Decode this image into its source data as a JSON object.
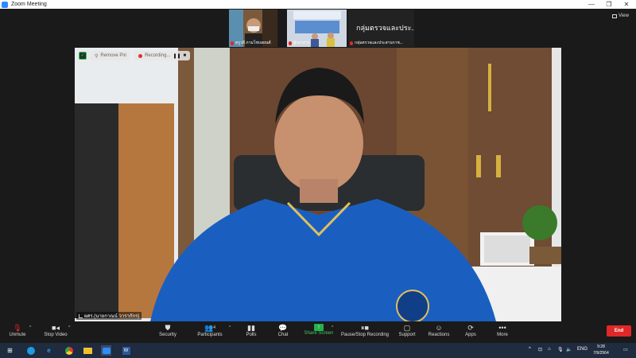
{
  "window": {
    "title": "Zoom Meeting",
    "minimize": "—",
    "maximize": "❐",
    "close": "✕"
  },
  "view_button": "View",
  "thumbnails": [
    {
      "name": "ครูวลี ภามโชบลยนต์"
    },
    {
      "name": "ผู้กสาภาร"
    },
    {
      "name": "กลุ่มตรวจและประสานราช...",
      "big_name": "กลุ่มตรวจและประ..."
    }
  ],
  "main_video": {
    "remove_pin": "Remove Pin",
    "recording": "Recording...",
    "speaker_name": "ผศร.(นายกาณน์ วารากักร)"
  },
  "toolbar": {
    "unmute": "Unmute",
    "stop_video": "Stop Video",
    "security": "Security",
    "participants": "Participants",
    "participants_count": "4",
    "polls": "Polls",
    "chat": "Chat",
    "share_screen": "Share Screen",
    "pause_stop_recording": "Pause/Stop Recording",
    "support": "Support",
    "reactions": "Reactions",
    "apps": "Apps",
    "more": "More",
    "end": "End"
  },
  "taskbar": {
    "language": "ENG",
    "time": "9:28",
    "date": "7/9/2564"
  },
  "colors": {
    "zoom_blue": "#2d8cff",
    "end_red": "#e02828",
    "share_green": "#22b14c",
    "shirt_blue": "#1a5fc0"
  }
}
